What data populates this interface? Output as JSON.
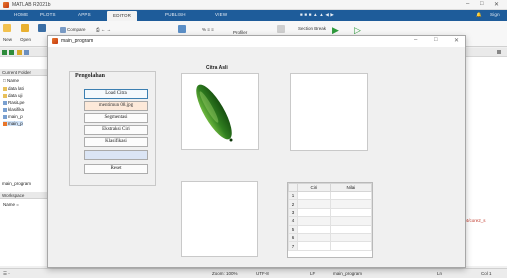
{
  "matlab": {
    "title": "MATLAB R2021b",
    "tabs": [
      "HOME",
      "PLOTS",
      "APPS",
      "EDITOR",
      "PUBLISH",
      "VIEW"
    ],
    "active_tab": "EDITOR",
    "search_placeholder": "Search Documentation",
    "sign_in": "Sign",
    "ribbon": {
      "new_label": "New",
      "open_label": "Open",
      "compare_label": "Compare",
      "profiler_label": "Profiler",
      "section_break_label": "Section Break"
    }
  },
  "left_panel": {
    "current_folder_label": "Current Folder",
    "name_header": "Name",
    "files": [
      "data lati",
      "data uji",
      "RasiLpe",
      "klasifika",
      "main_p",
      "main_p"
    ],
    "editor_file": "main_program",
    "workspace_label": "Workspace",
    "workspace_name_header": "Name ="
  },
  "right_panel": {
    "tab_label": "ram.m",
    "link_text": "mebrn4/core2_s"
  },
  "status": {
    "left": "☰ -",
    "zoom": "Zoom: 100%",
    "encoding": "UTF-8",
    "eol": "LF",
    "file": "main_program",
    "ln": "Ln",
    "col": "Col 1"
  },
  "figure": {
    "window_title": "main_program",
    "panel_title": "Pengolahan",
    "buttons": {
      "load": "Load Citra",
      "segment": "Segmentasi",
      "extract": "Ekstraksi Ciri",
      "classify": "Klasifikasi",
      "reset": "Reset"
    },
    "filename_field": "mentimun 08.jpg",
    "result_field": "",
    "axes_title": "Citra Asli",
    "table": {
      "columns": [
        "Ciri",
        "Nilai"
      ],
      "row_numbers": [
        "1",
        "2",
        "3",
        "4",
        "5",
        "6",
        "7"
      ]
    }
  },
  "colors": {
    "ribbon_blue": "#1e5c9a",
    "filename_field_bg": "#fde9d9",
    "result_field_bg": "#dbe5f5",
    "cucumber_dark": "#1f6b16",
    "cucumber_light": "#7fc548"
  }
}
